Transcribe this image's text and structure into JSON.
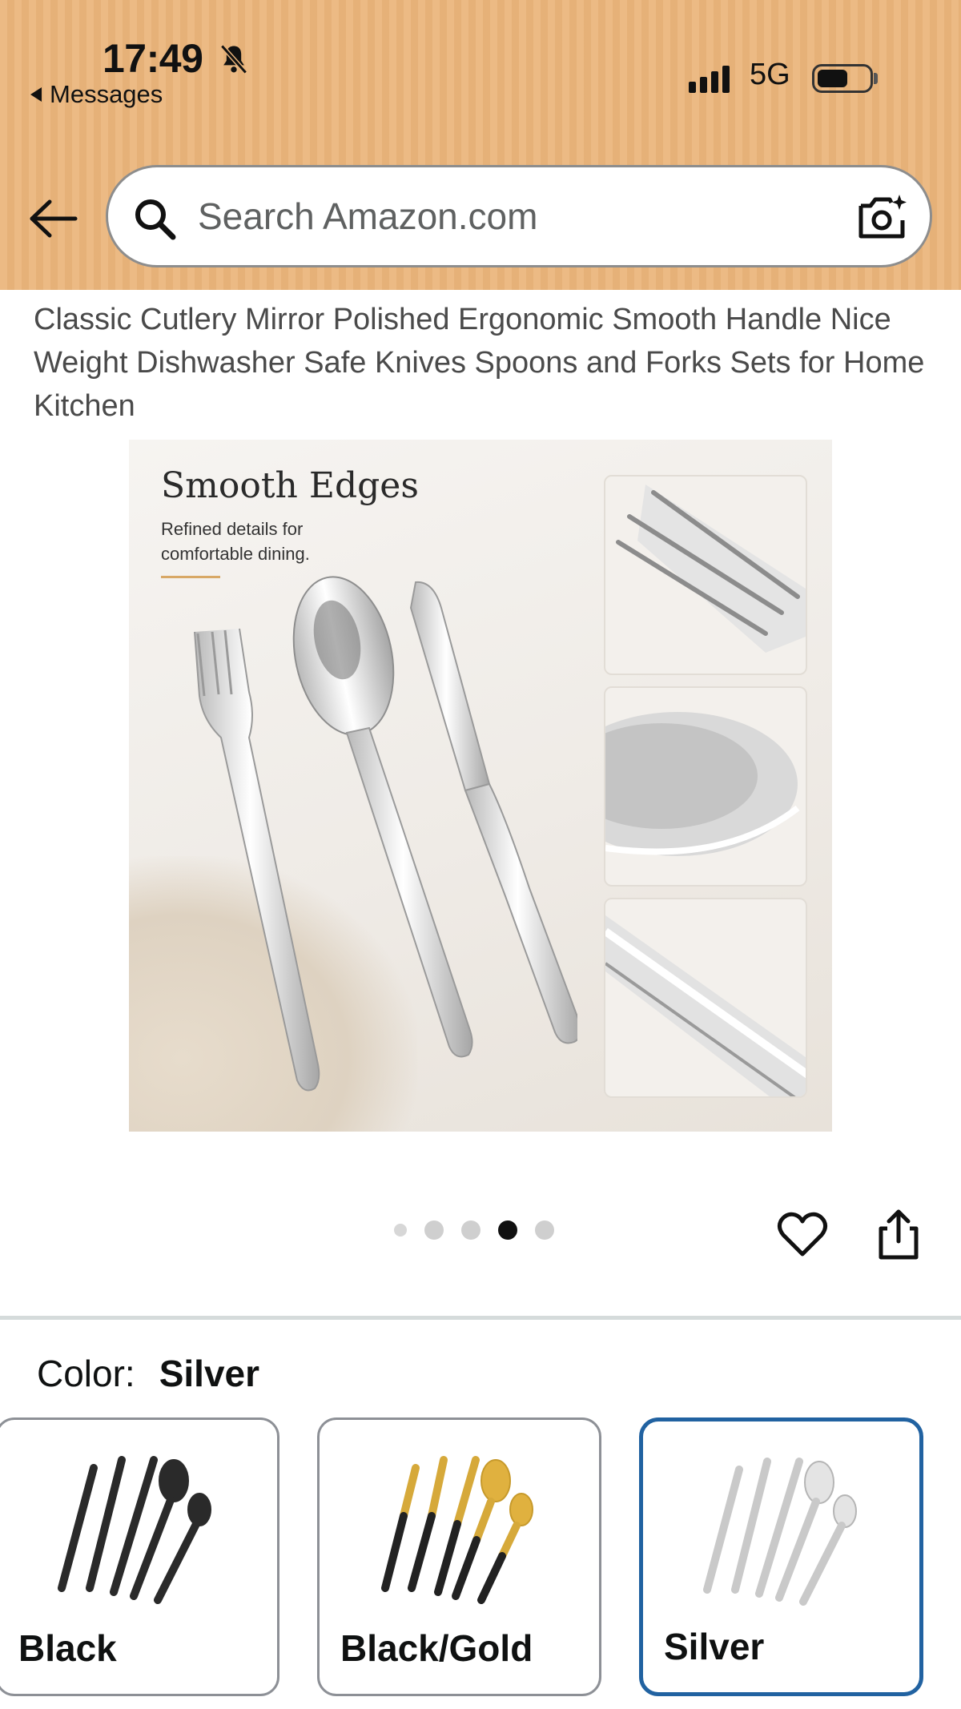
{
  "status_bar": {
    "time": "17:49",
    "back_app": "Messages",
    "network": "5G",
    "icons": [
      "bell-slash-icon",
      "signal-icon",
      "battery-icon"
    ]
  },
  "search": {
    "placeholder": "Search Amazon.com",
    "icons": [
      "back-arrow-icon",
      "search-icon",
      "camera-search-icon"
    ]
  },
  "product": {
    "title": "Classic Cutlery Mirror Polished Ergonomic Smooth Handle Nice Weight Dishwasher Safe Knives Spoons and Forks Sets for Home Kitchen"
  },
  "image": {
    "heading": "Smooth Edges",
    "subtext": "Refined details for comfortable dining."
  },
  "carousel": {
    "total": 5,
    "active_index": 3
  },
  "actions": {
    "icons": [
      "heart-icon",
      "share-icon"
    ]
  },
  "variant": {
    "label": "Color:",
    "selected": "Silver",
    "options": [
      {
        "name": "Black"
      },
      {
        "name": "Black/Gold"
      },
      {
        "name": "Silver"
      }
    ]
  },
  "colors": {
    "header_bg": "#ebb57b",
    "selected_border": "#2162a1",
    "divider": "#d5dbdb"
  }
}
